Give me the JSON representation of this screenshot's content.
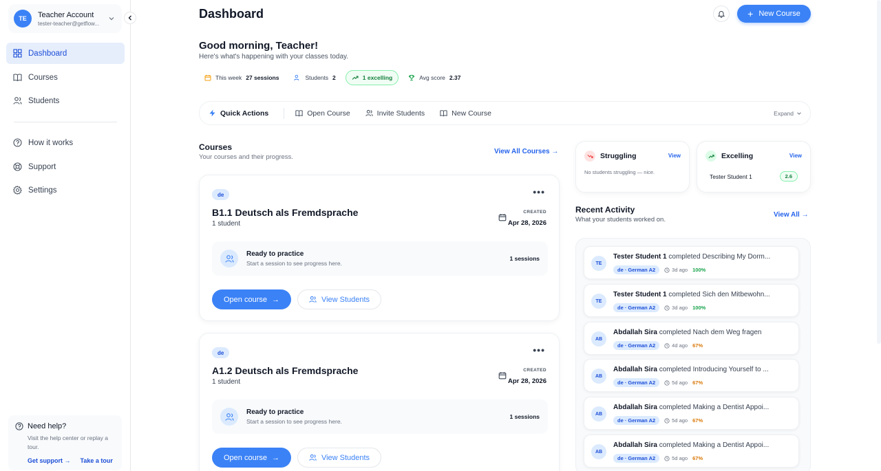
{
  "colors": {
    "accent": "#3b82f6",
    "active_nav_bg": "#e6eefc",
    "success": "#15803d",
    "warning": "#d97706",
    "danger": "#ef4444"
  },
  "account": {
    "initials": "TE",
    "name": "Teacher Account",
    "email": "tester-teacher@getflow..."
  },
  "nav": [
    {
      "label": "Dashboard",
      "icon": "grid-icon",
      "active": true
    },
    {
      "label": "Courses",
      "icon": "book-icon",
      "active": false
    },
    {
      "label": "Students",
      "icon": "users-icon",
      "active": false
    },
    {
      "label": "How it works",
      "icon": "help-circle-icon",
      "active": false
    },
    {
      "label": "Support",
      "icon": "lifebuoy-icon",
      "active": false
    },
    {
      "label": "Settings",
      "icon": "gear-icon",
      "active": false
    }
  ],
  "help": {
    "title": "Need help?",
    "desc": "Visit the help center or replay a tour.",
    "link1": "Get support",
    "link2": "Take a tour"
  },
  "header": {
    "title": "Dashboard",
    "new_course": "New Course"
  },
  "greeting": {
    "title": "Good morning, Teacher!",
    "subtitle": "Here's what's happening with your classes today."
  },
  "stats": {
    "week_label": "This week",
    "week_value": "27 sessions",
    "students_label": "Students",
    "students_value": "2",
    "excelling": "1 excelling",
    "avg_label": "Avg score",
    "avg_value": "2.37"
  },
  "quick_actions": {
    "title": "Quick Actions",
    "open_course": "Open Course",
    "invite": "Invite Students",
    "new_course": "New Course",
    "expand": "Expand"
  },
  "courses_section": {
    "title": "Courses",
    "subtitle": "Your courses and their progress.",
    "view_all": "View All Courses"
  },
  "courses": [
    {
      "lang": "de",
      "title": "B1.1 Deutsch als Fremdsprache",
      "students": "1 student",
      "created_label": "CREATED",
      "created": "Apr 28, 2026",
      "ready_title": "Ready to practice",
      "ready_sub": "Start a session to see progress here.",
      "sessions": "1 sessions",
      "open": "Open course",
      "view": "View Students"
    },
    {
      "lang": "de",
      "title": "A1.2 Deutsch als Fremdsprache",
      "students": "1 student",
      "created_label": "CREATED",
      "created": "Apr 28, 2026",
      "ready_title": "Ready to practice",
      "ready_sub": "Start a session to see progress here.",
      "sessions": "1 sessions",
      "open": "Open course",
      "view": "View Students"
    }
  ],
  "struggling": {
    "title": "Struggling",
    "view": "View",
    "empty": "No students struggling — nice."
  },
  "excelling": {
    "title": "Excelling",
    "view": "View",
    "student": "Tester Student 1",
    "score": "2.6"
  },
  "activity_section": {
    "title": "Recent Activity",
    "subtitle": "What your students worked on.",
    "view_all": "View All"
  },
  "activities": [
    {
      "initials": "TE",
      "name": "Tester Student 1",
      "verb": "completed",
      "item": "Describing My Dorm...",
      "lang": "de · German A2",
      "time": "3d ago",
      "pct": "100%",
      "pct_color": "#16a34a"
    },
    {
      "initials": "TE",
      "name": "Tester Student 1",
      "verb": "completed",
      "item": "Sich den Mitbewohn...",
      "lang": "de · German A2",
      "time": "3d ago",
      "pct": "100%",
      "pct_color": "#16a34a"
    },
    {
      "initials": "AB",
      "name": "Abdallah Sira",
      "verb": "completed",
      "item": "Nach dem Weg fragen",
      "lang": "de · German A2",
      "time": "4d ago",
      "pct": "67%",
      "pct_color": "#d97706"
    },
    {
      "initials": "AB",
      "name": "Abdallah Sira",
      "verb": "completed",
      "item": "Introducing Yourself to ...",
      "lang": "de · German A2",
      "time": "5d ago",
      "pct": "67%",
      "pct_color": "#d97706"
    },
    {
      "initials": "AB",
      "name": "Abdallah Sira",
      "verb": "completed",
      "item": "Making a Dentist Appoi...",
      "lang": "de · German A2",
      "time": "5d ago",
      "pct": "67%",
      "pct_color": "#d97706"
    },
    {
      "initials": "AB",
      "name": "Abdallah Sira",
      "verb": "completed",
      "item": "Making a Dentist Appoi...",
      "lang": "de · German A2",
      "time": "5d ago",
      "pct": "67%",
      "pct_color": "#d97706"
    }
  ]
}
